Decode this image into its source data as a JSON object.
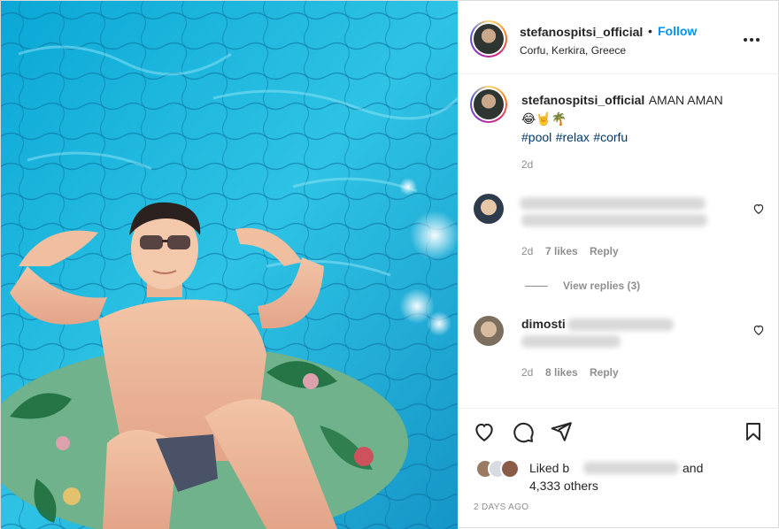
{
  "post": {
    "author": {
      "username": "stefanospitsi_official",
      "follow_label": "Follow",
      "separator": "•",
      "location": "Corfu, Kerkira, Greece"
    },
    "more_icon": "more-horizontal-icon",
    "caption": {
      "username": "stefanospitsi_official",
      "text": "AMAN AMAN",
      "emojis": "😂🤘🌴",
      "hashtags": [
        "#pool",
        "#relax",
        "#corfu"
      ],
      "time": "2d"
    },
    "comments": [
      {
        "username_visible": "",
        "time": "2d",
        "likes": "7 likes",
        "reply_label": "Reply",
        "view_replies": "View replies (3)"
      },
      {
        "username_visible": "dimosti",
        "time": "2d",
        "likes": "8 likes",
        "reply_label": "Reply"
      }
    ],
    "actions": {
      "like_icon": "heart-icon",
      "comment_icon": "comment-icon",
      "share_icon": "send-icon",
      "save_icon": "bookmark-icon"
    },
    "likes": {
      "liked_by_label": "Liked b",
      "and_label": "and",
      "others": "4,333 others"
    },
    "posted_ago": "2 DAYS AGO"
  },
  "colors": {
    "accent": "#0095f6",
    "hashtag": "#00376b",
    "muted": "#8e8e8e",
    "pool": "#1fb4d8"
  }
}
